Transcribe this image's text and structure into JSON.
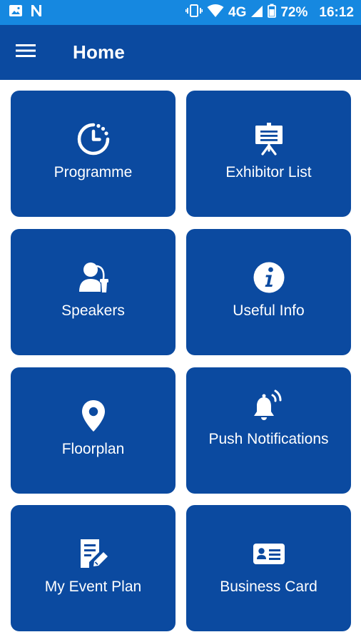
{
  "status_bar": {
    "network": "4G",
    "battery": "72%",
    "time": "16:12",
    "icons": [
      "image-icon",
      "n-icon",
      "vibrate-icon",
      "wifi-icon",
      "signal-icon",
      "battery-icon"
    ]
  },
  "app_bar": {
    "title": "Home",
    "menu_icon": "hamburger-menu-icon"
  },
  "tiles": [
    {
      "label": "Programme",
      "icon": "clock-icon"
    },
    {
      "label": "Exhibitor List",
      "icon": "presentation-board-icon"
    },
    {
      "label": "Speakers",
      "icon": "speaker-podium-icon"
    },
    {
      "label": "Useful Info",
      "icon": "info-icon"
    },
    {
      "label": "Floorplan",
      "icon": "map-pin-icon"
    },
    {
      "label": "Push Notifications",
      "icon": "bell-ringing-icon"
    },
    {
      "label": "My Event Plan",
      "icon": "document-edit-icon"
    },
    {
      "label": "Business Card",
      "icon": "id-card-icon"
    }
  ],
  "colors": {
    "status_bar": "#1688e0",
    "primary": "#0b4aa0",
    "text": "#ffffff"
  }
}
